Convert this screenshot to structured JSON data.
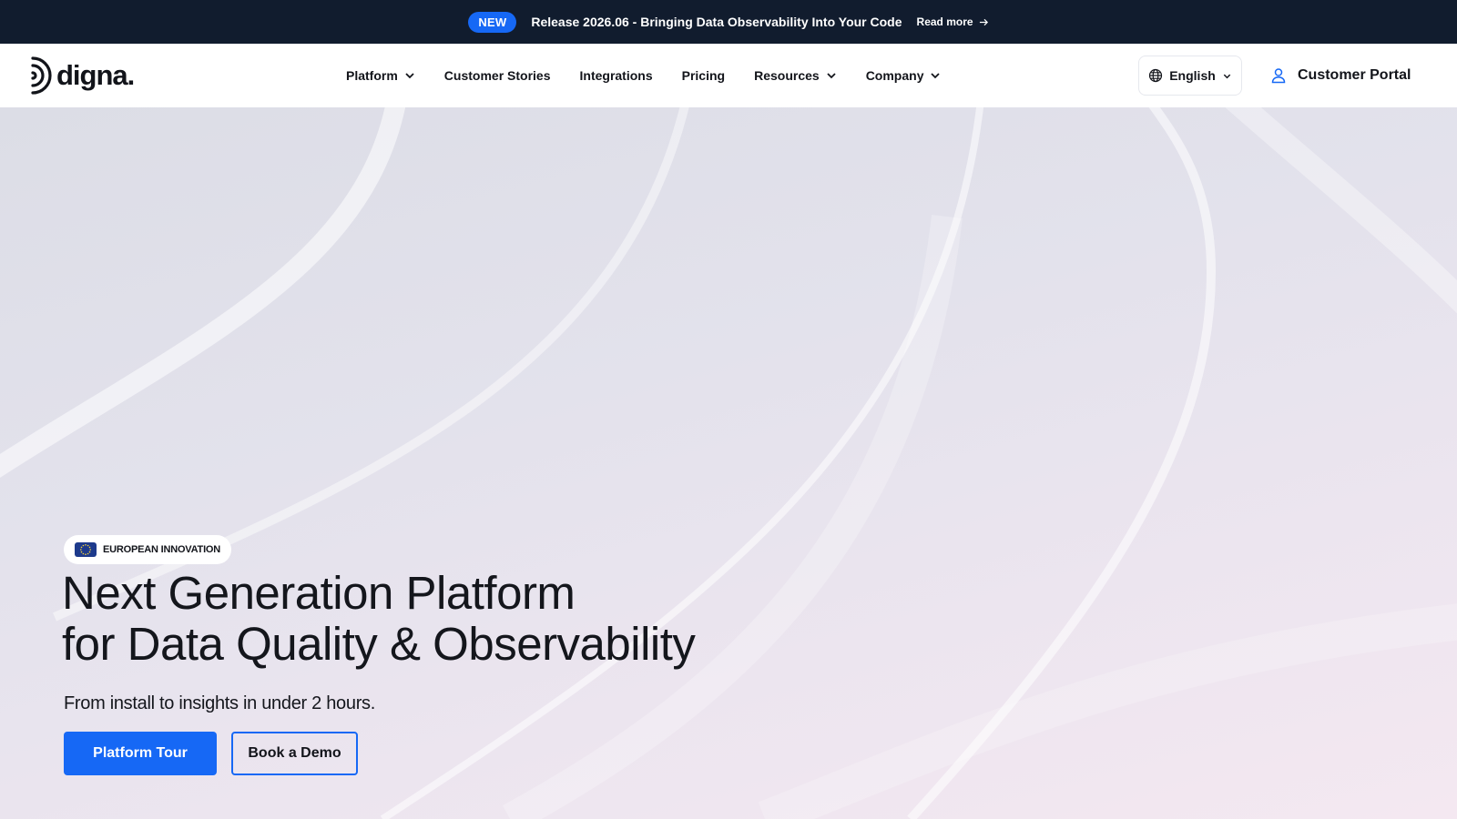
{
  "announcement": {
    "badge": "NEW",
    "text": "Release 2026.06 - Bringing Data Observability Into Your Code",
    "link_label": "Read more"
  },
  "header": {
    "logo_text": "digna.",
    "nav": [
      {
        "label": "Platform",
        "has_dropdown": true
      },
      {
        "label": "Customer Stories",
        "has_dropdown": false
      },
      {
        "label": "Integrations",
        "has_dropdown": false
      },
      {
        "label": "Pricing",
        "has_dropdown": false
      },
      {
        "label": "Resources",
        "has_dropdown": true
      },
      {
        "label": "Company",
        "has_dropdown": true
      }
    ],
    "language": "English",
    "portal_label": "Customer Portal"
  },
  "hero": {
    "pill_label": "EUROPEAN INNOVATION",
    "title_line1": "Next Generation Platform",
    "title_line2": "for Data Quality & Observability",
    "subtitle": "From install to insights in under 2 hours.",
    "primary_cta": "Platform Tour",
    "secondary_cta": "Book a Demo"
  },
  "colors": {
    "topbar": "#111c2e",
    "accent": "#1668f5",
    "text": "#12141a"
  }
}
